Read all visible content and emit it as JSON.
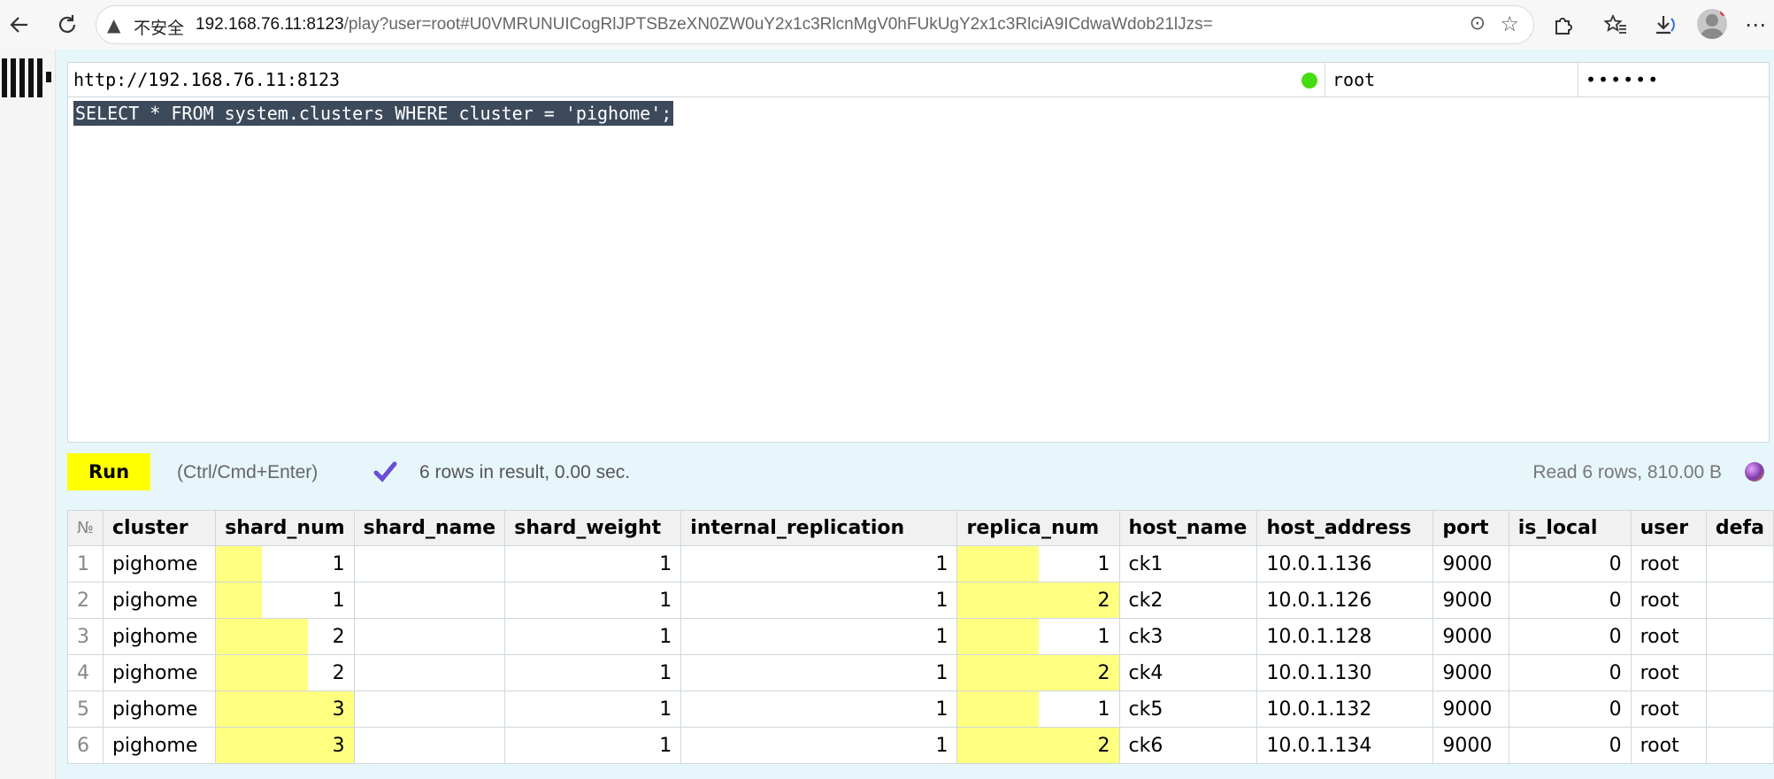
{
  "browser": {
    "insecure_label": "不安全",
    "url_host": "192.168.76.11:8123",
    "url_rest": "/play?user=root#U0VMRUNUICogRlJPTSBzeXN0ZW0uY2x1c3RlcnMgV0hFUkUgY2x1c3RlciA9ICdwaWdob21lJzs=",
    "icons": [
      "back-icon",
      "refresh-icon",
      "warning-icon",
      "more-icon",
      "favorite-star-icon",
      "extensions-icon",
      "favorites-icon",
      "download-icon",
      "profile-icon",
      "menu-icon"
    ]
  },
  "play": {
    "url": "http://192.168.76.11:8123",
    "user": "root",
    "password": "••••••",
    "query": "SELECT * FROM system.clusters WHERE cluster = 'pighome';",
    "run_label": "Run",
    "hint": "(Ctrl/Cmd+Enter)",
    "stats": "6 rows in result, 0.00 sec.",
    "read": "Read 6 rows, 810.00 B"
  },
  "table": {
    "columns": [
      "№",
      "cluster",
      "shard_num",
      "shard_name",
      "shard_weight",
      "internal_replication",
      "replica_num",
      "host_name",
      "host_address",
      "port",
      "is_local",
      "user",
      "defa"
    ],
    "rows": [
      {
        "n": "1",
        "cluster": "pighome",
        "shard_num": "1",
        "shard_name": "",
        "shard_weight": "1",
        "internal_replication": "1",
        "replica_num": "1",
        "host_name": "ck1",
        "host_address": "10.0.1.136",
        "port": "9000",
        "is_local": "0",
        "user": "root",
        "default": ""
      },
      {
        "n": "2",
        "cluster": "pighome",
        "shard_num": "1",
        "shard_name": "",
        "shard_weight": "1",
        "internal_replication": "1",
        "replica_num": "2",
        "host_name": "ck2",
        "host_address": "10.0.1.126",
        "port": "9000",
        "is_local": "0",
        "user": "root",
        "default": ""
      },
      {
        "n": "3",
        "cluster": "pighome",
        "shard_num": "2",
        "shard_name": "",
        "shard_weight": "1",
        "internal_replication": "1",
        "replica_num": "1",
        "host_name": "ck3",
        "host_address": "10.0.1.128",
        "port": "9000",
        "is_local": "0",
        "user": "root",
        "default": ""
      },
      {
        "n": "4",
        "cluster": "pighome",
        "shard_num": "2",
        "shard_name": "",
        "shard_weight": "1",
        "internal_replication": "1",
        "replica_num": "2",
        "host_name": "ck4",
        "host_address": "10.0.1.130",
        "port": "9000",
        "is_local": "0",
        "user": "root",
        "default": ""
      },
      {
        "n": "5",
        "cluster": "pighome",
        "shard_num": "3",
        "shard_name": "",
        "shard_weight": "1",
        "internal_replication": "1",
        "replica_num": "1",
        "host_name": "ck5",
        "host_address": "10.0.1.132",
        "port": "9000",
        "is_local": "0",
        "user": "root",
        "default": ""
      },
      {
        "n": "6",
        "cluster": "pighome",
        "shard_num": "3",
        "shard_name": "",
        "shard_weight": "1",
        "internal_replication": "1",
        "replica_num": "2",
        "host_name": "ck6",
        "host_address": "10.0.1.134",
        "port": "9000",
        "is_local": "0",
        "user": "root",
        "default": ""
      }
    ],
    "bar_columns": {
      "shard_num": 3,
      "replica_num": 2
    }
  },
  "colors": {
    "bar_fill": "#ffff80",
    "run_button": "#ffff00",
    "status_ok": "#44dd11",
    "content_bg": "#e6f6fa"
  }
}
